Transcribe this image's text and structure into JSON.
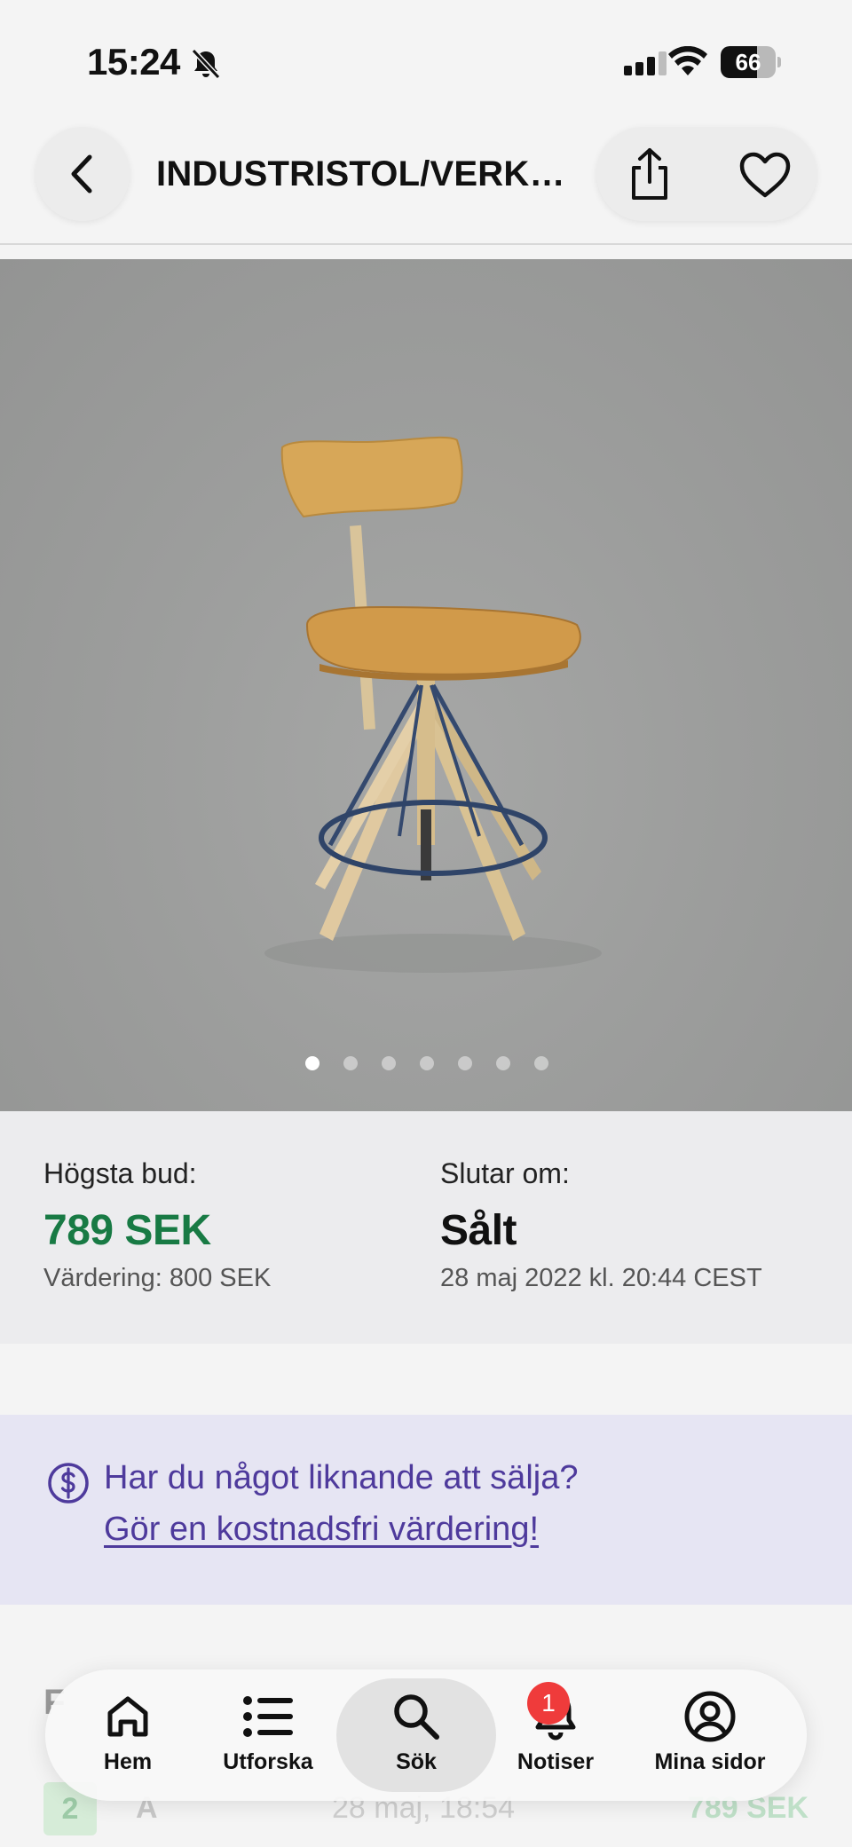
{
  "status_bar": {
    "time": "15:24",
    "battery_level": "66",
    "icons": [
      "bell-off-icon",
      "cellular-signal-icon",
      "wifi-icon",
      "battery-icon"
    ]
  },
  "header": {
    "title": "INDUSTRISTOL/VERKSTADSSTOL",
    "icons": [
      "back-chevron-icon",
      "share-icon",
      "heart-icon"
    ]
  },
  "gallery": {
    "image_count": 7,
    "active_index": 0
  },
  "auction": {
    "highest_bid_label": "Högsta bud:",
    "highest_bid_value": "789 SEK",
    "valuation": "Värdering: 800 SEK",
    "ends_label": "Slutar om:",
    "status_value": "Sålt",
    "end_date": "28 maj 2022 kl. 20:44 CEST"
  },
  "promo": {
    "question": "Har du något liknande att sälja?",
    "link_text": "Gör en kostnadsfri värdering!",
    "icon": "dollar-circle-icon"
  },
  "bids": {
    "heading": "F",
    "rows": [
      {
        "number": "2",
        "bidder": "A",
        "time": "28 maj, 18:54",
        "amount": "789 SEK"
      }
    ]
  },
  "tab_bar": {
    "active": "Sök",
    "tabs": [
      {
        "label": "Hem",
        "icon": "home-icon"
      },
      {
        "label": "Utforska",
        "icon": "list-icon"
      },
      {
        "label": "Sök",
        "icon": "search-icon"
      },
      {
        "label": "Notiser",
        "icon": "bell-icon"
      },
      {
        "label": "Mina sidor",
        "icon": "user-circle-icon"
      }
    ],
    "notification_count": "1"
  },
  "colors": {
    "accent_green": "#187a44",
    "promo_purple": "#4e3a9c",
    "promo_background": "#e6e5f3",
    "badge_red": "#ef3b3b"
  }
}
